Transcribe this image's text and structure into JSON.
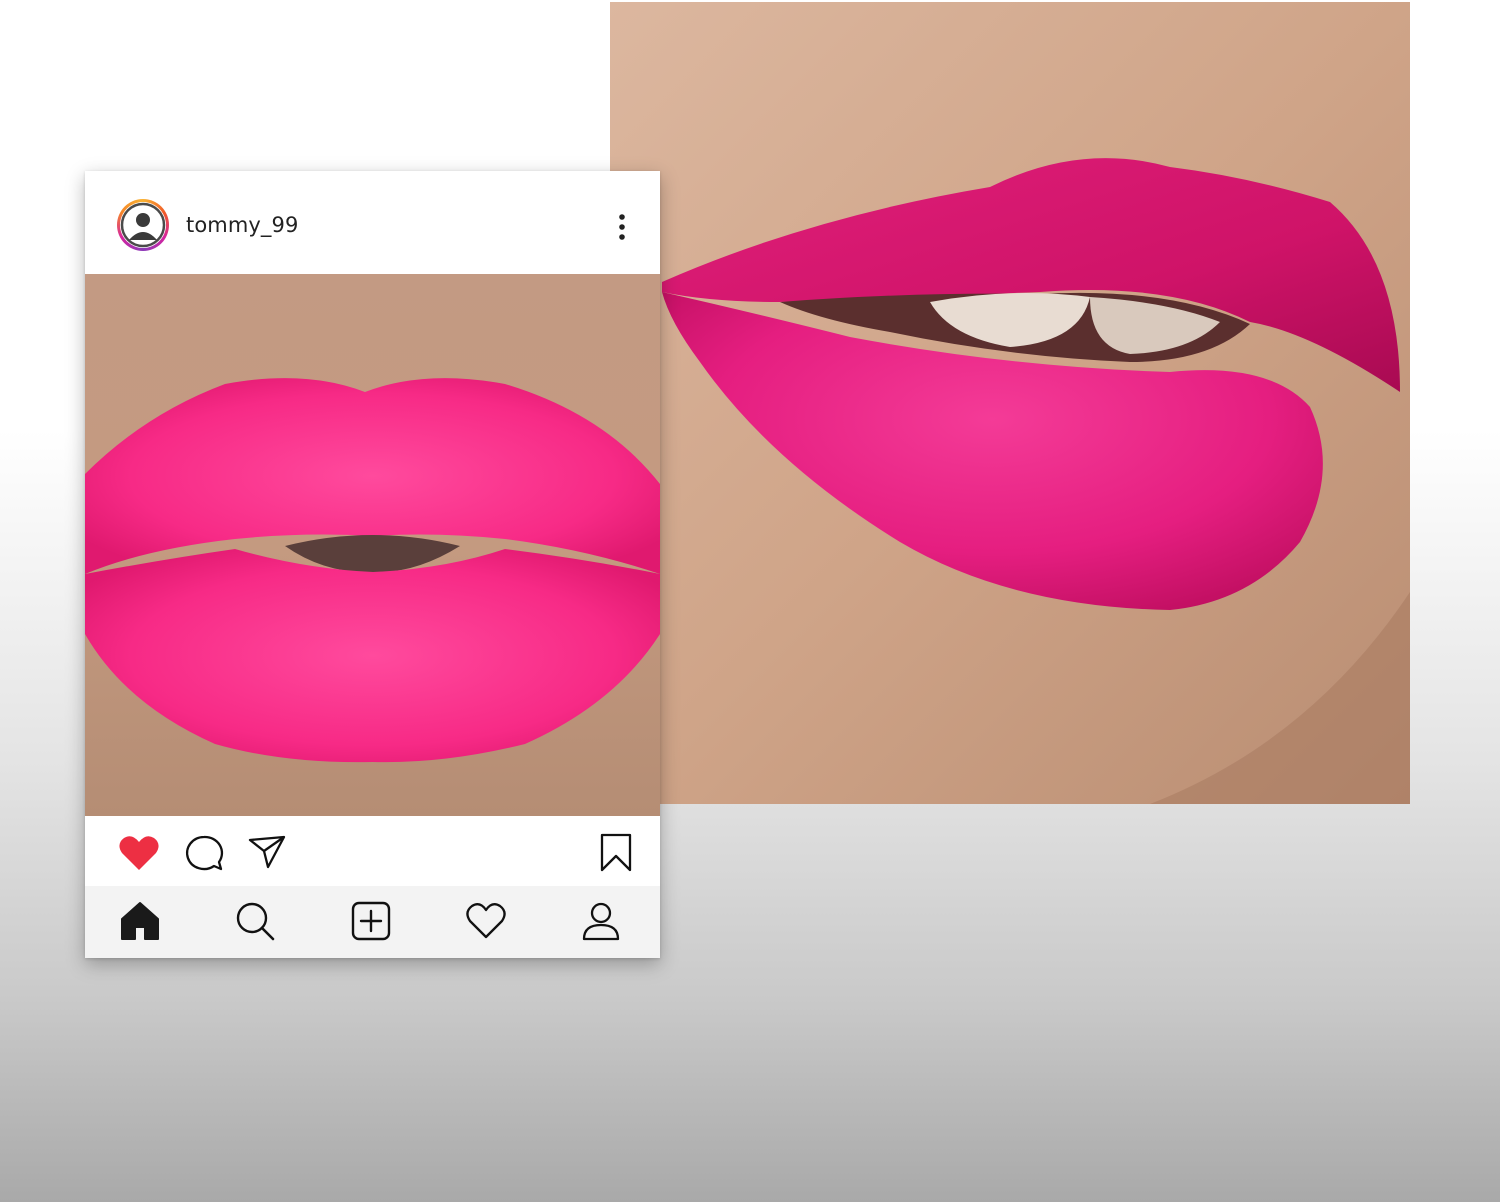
{
  "post": {
    "username": "tommy_99",
    "liked": true,
    "like_color": "#ed2f43"
  },
  "icons": {
    "header": [
      "avatar-icon",
      "more-options-icon"
    ],
    "actions": [
      "heart-filled-icon",
      "comment-icon",
      "share-icon",
      "bookmark-icon"
    ],
    "bottom_nav": [
      "home-icon",
      "search-icon",
      "add-post-icon",
      "activity-heart-icon",
      "profile-icon"
    ]
  },
  "colors": {
    "lipstick_pink": "#f2277f",
    "lipstick_magenta": "#d51470",
    "skin_tone": "#c79b7f",
    "nav_background": "#f3f3f3"
  }
}
